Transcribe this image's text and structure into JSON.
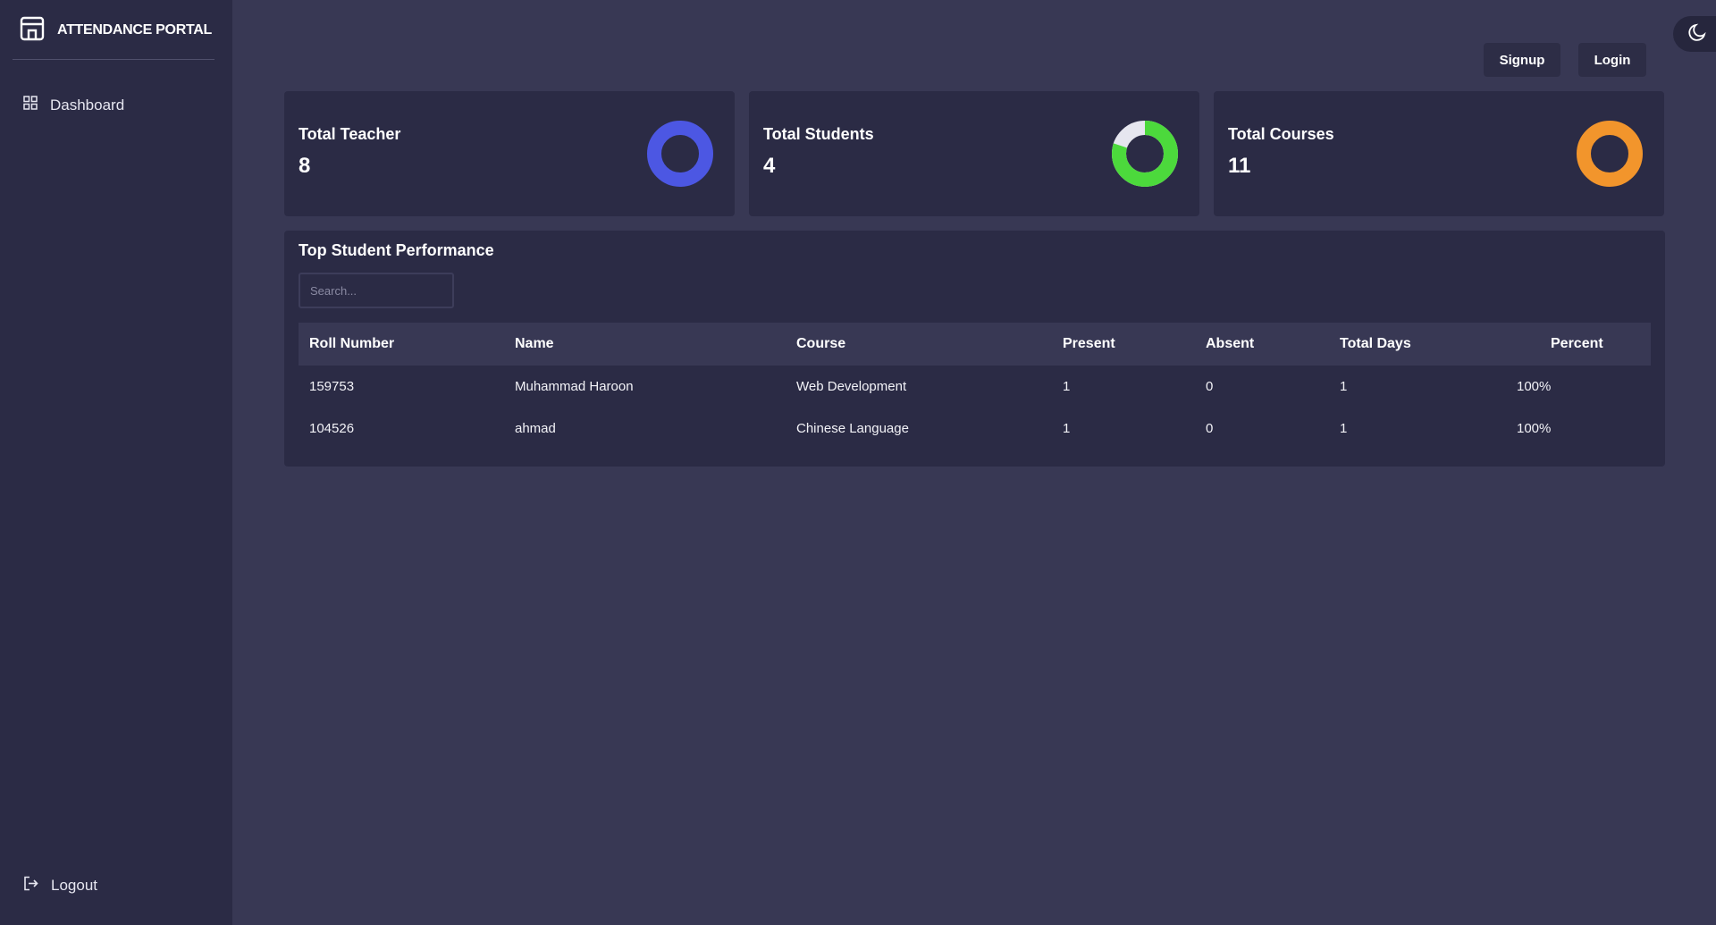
{
  "sidebar": {
    "brand": "ATTENDANCE PORTAL",
    "nav": [
      {
        "label": "Dashboard",
        "icon": "grid-icon"
      }
    ],
    "logout_label": "Logout"
  },
  "header": {
    "signup_label": "Signup",
    "login_label": "Login",
    "theme_icon": "moon-icon"
  },
  "stats": [
    {
      "label": "Total Teacher",
      "value": "8",
      "color": "#4c57e3"
    },
    {
      "label": "Total Students",
      "value": "4",
      "color": "#4cd93c",
      "remainder_color": "#e6e6ef",
      "fill_fraction": 0.8
    },
    {
      "label": "Total Courses",
      "value": "11",
      "color": "#f2952c"
    }
  ],
  "performance": {
    "title": "Top Student Performance",
    "search_placeholder": "Search...",
    "columns": [
      "Roll Number",
      "Name",
      "Course",
      "Present",
      "Absent",
      "Total Days",
      "Percent"
    ],
    "rows": [
      [
        "159753",
        "Muhammad Haroon",
        "Web Development",
        "1",
        "0",
        "1",
        "100%"
      ],
      [
        "104526",
        "ahmad",
        "Chinese Language",
        "1",
        "0",
        "1",
        "100%"
      ]
    ]
  },
  "colors": {
    "background": "#383854",
    "panel": "#2b2b45"
  }
}
